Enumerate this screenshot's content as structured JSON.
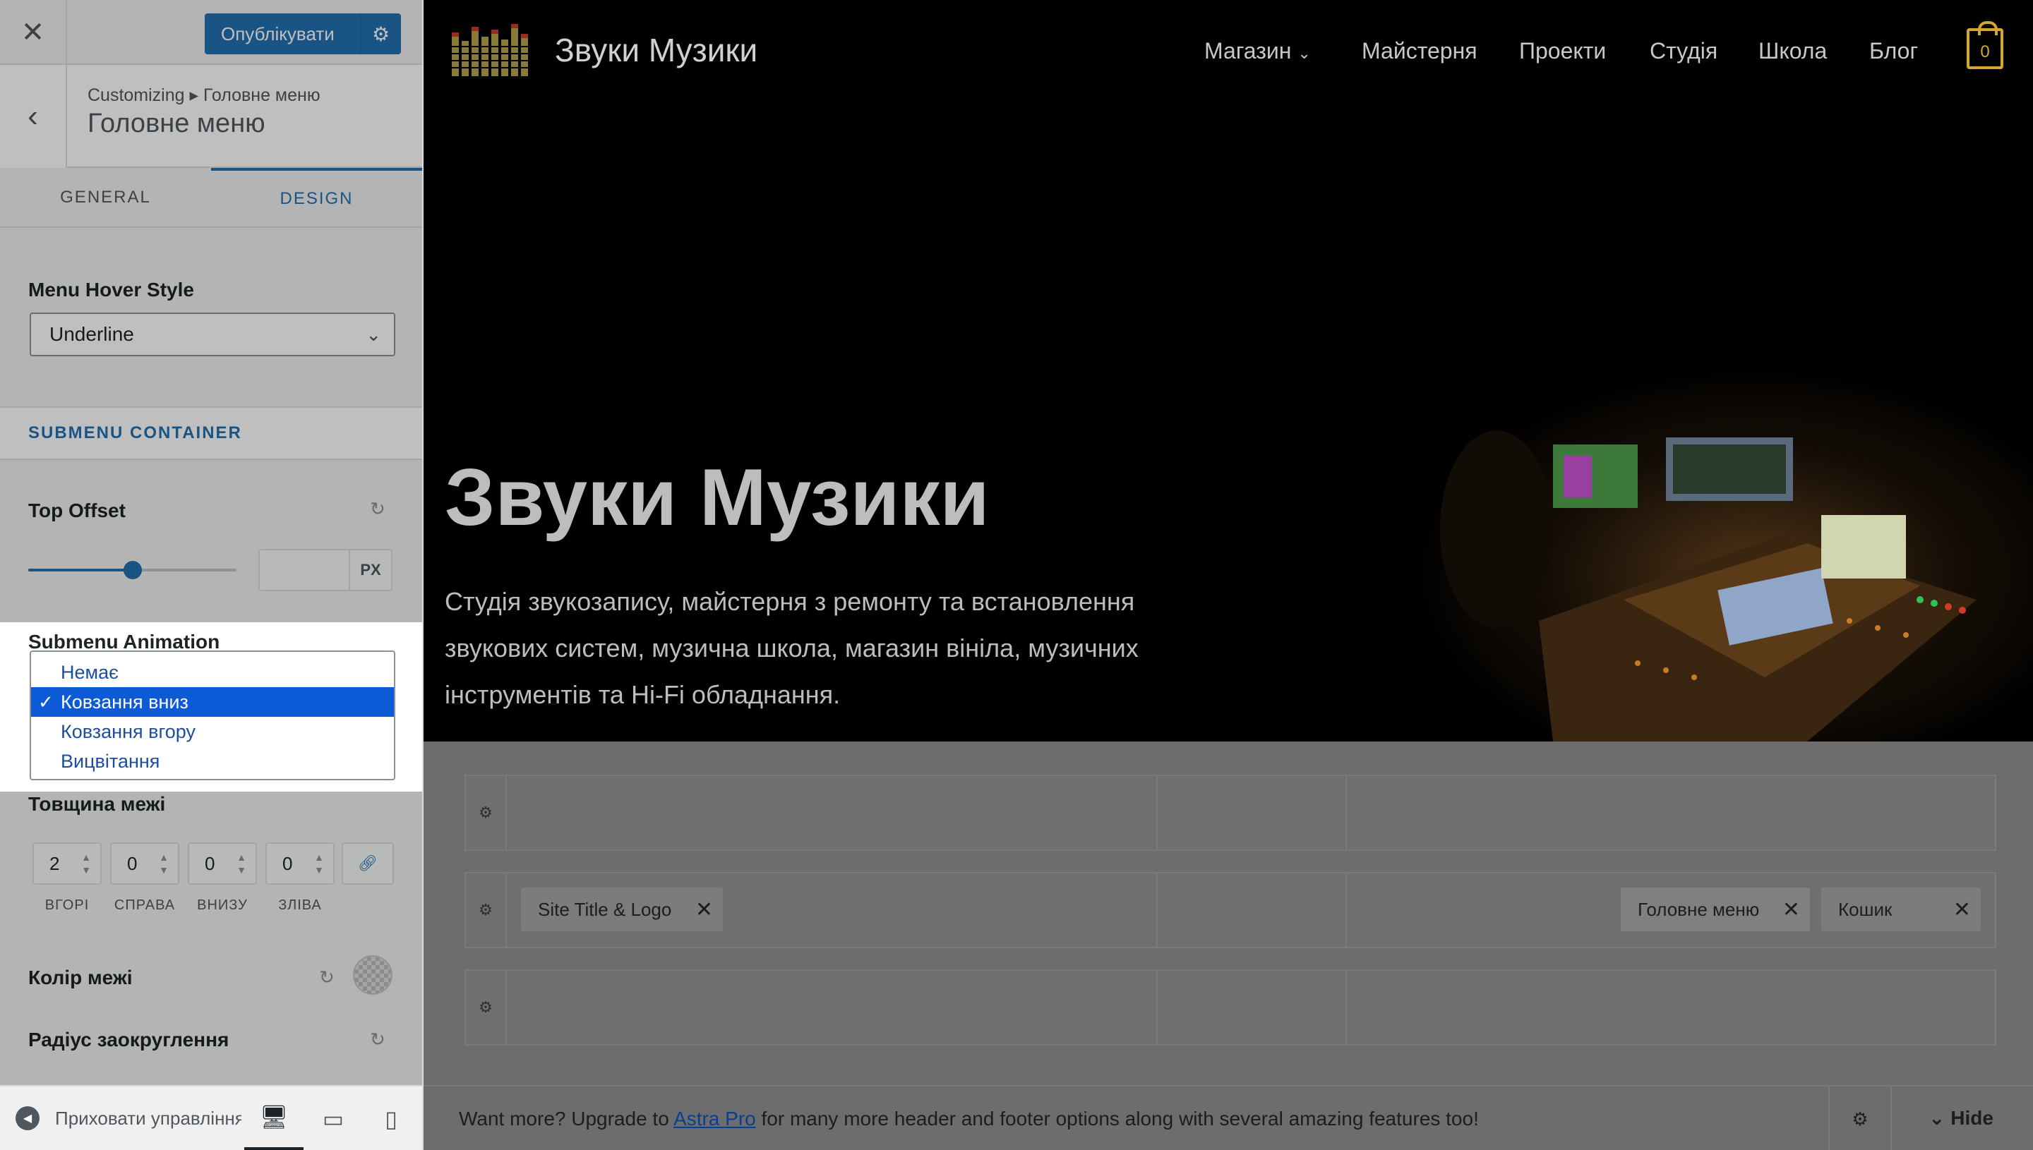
{
  "sidebar": {
    "publish_label": "Опублікувати",
    "breadcrumb": "Customizing ▸ Головне меню",
    "section_title": "Головне меню",
    "tabs": [
      {
        "label": "GENERAL",
        "active": false
      },
      {
        "label": "DESIGN",
        "active": true
      }
    ],
    "menu_hover_style": {
      "label": "Menu Hover Style",
      "value": "Underline"
    },
    "submenu_container_label": "SUBMENU CONTAINER",
    "top_offset": {
      "label": "Top Offset",
      "value": "",
      "unit": "PX",
      "slider_fraction": 0.5
    },
    "submenu_animation": {
      "label": "Submenu Animation",
      "options": [
        {
          "label": "Немає",
          "selected": false
        },
        {
          "label": "Ковзання вниз",
          "selected": true
        },
        {
          "label": "Ковзання вгору",
          "selected": false
        },
        {
          "label": "Вицвітання",
          "selected": false
        }
      ]
    },
    "border_width": {
      "label": "Товщина межі",
      "values": [
        {
          "value": "2",
          "caption": "ВГОРІ"
        },
        {
          "value": "0",
          "caption": "СПРАВА"
        },
        {
          "value": "0",
          "caption": "ВНИЗУ"
        },
        {
          "value": "0",
          "caption": "ЗЛІВА"
        }
      ]
    },
    "border_color_label": "Колір межі",
    "border_radius_label": "Радіус заокруглення",
    "hide_controls_label": "Приховати управління"
  },
  "preview": {
    "site_title": "Звуки Музики",
    "nav": [
      "Магазин",
      "Майстерня",
      "Проекти",
      "Студія",
      "Школа",
      "Блог"
    ],
    "cart_count": "0",
    "hero_title": "Звуки Музики",
    "hero_text": "Студія звукозапису, майстерня з ремонту та встановлення звукових систем, музична школа, магазин вініла, музичних інструментів та Hi-Fi обладнання.",
    "builder_chips": {
      "site_title_logo": "Site Title & Logo",
      "primary_menu": "Головне меню",
      "cart": "Кошик"
    }
  },
  "bottom_bar": {
    "text_before": "Want more? Upgrade to ",
    "link": "Astra Pro",
    "text_after": " for many more header and footer options along with several amazing features too!",
    "hide_label": "Hide"
  },
  "colors": {
    "accent": "#2271b1",
    "selected_option": "#0c5ad6",
    "cart": "#d4a72c"
  }
}
